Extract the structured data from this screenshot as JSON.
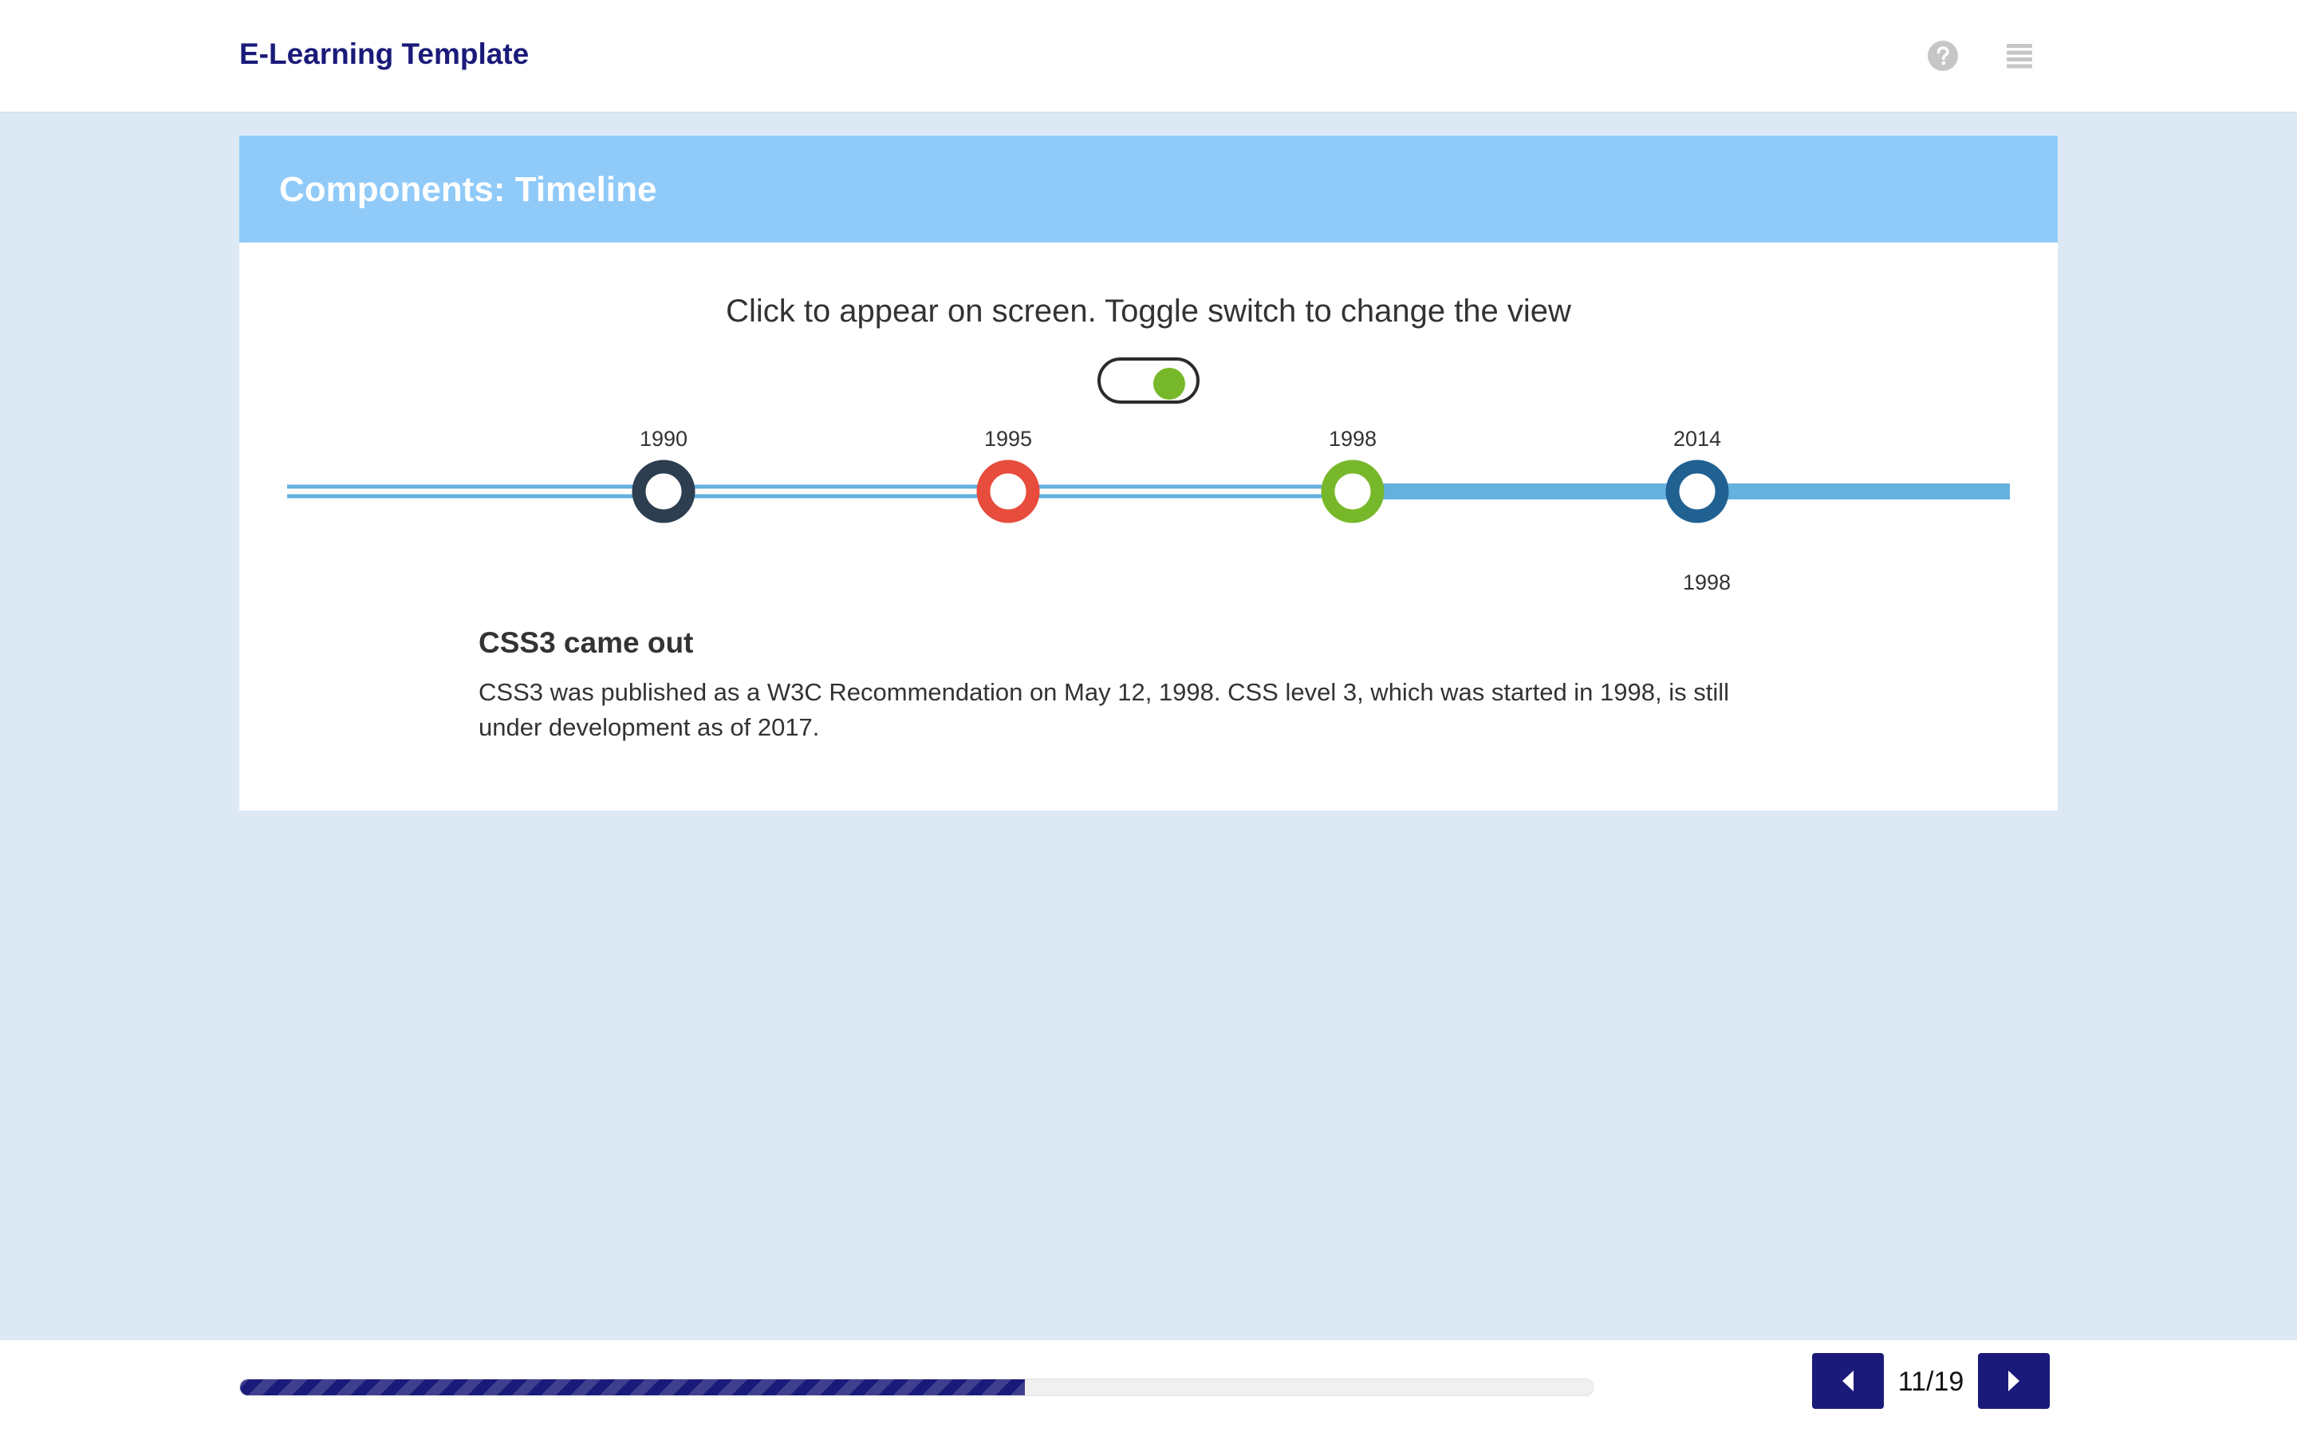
{
  "header": {
    "app_title": "E-Learning Template",
    "help_icon": "question-circle-icon",
    "menu_icon": "hamburger-menu-icon"
  },
  "page": {
    "title": "Components: Timeline",
    "instruction": "Click to appear on screen. Toggle switch to change the view"
  },
  "toggle": {
    "state": "on",
    "knob_color": "#77b82a"
  },
  "timeline": {
    "events": [
      {
        "year": "1990",
        "color": "#2c3e50"
      },
      {
        "year": "1995",
        "color": "#e74c3c"
      },
      {
        "year": "1998",
        "color": "#77b82a"
      },
      {
        "year": "2014",
        "color": "#216192"
      }
    ],
    "line_color": "#64b0df",
    "selected_year_label": "1998"
  },
  "detail": {
    "title": "CSS3 came out",
    "text": "CSS3 was published as a W3C Recommendation on May 12, 1998. CSS level 3, which was started in 1998, is still under development as of 2017."
  },
  "footer": {
    "progress_fraction": 0.58,
    "page_counter": "11/19",
    "prev_icon": "caret-left-icon",
    "next_icon": "caret-right-icon",
    "accent_color": "#1a1a7a"
  }
}
